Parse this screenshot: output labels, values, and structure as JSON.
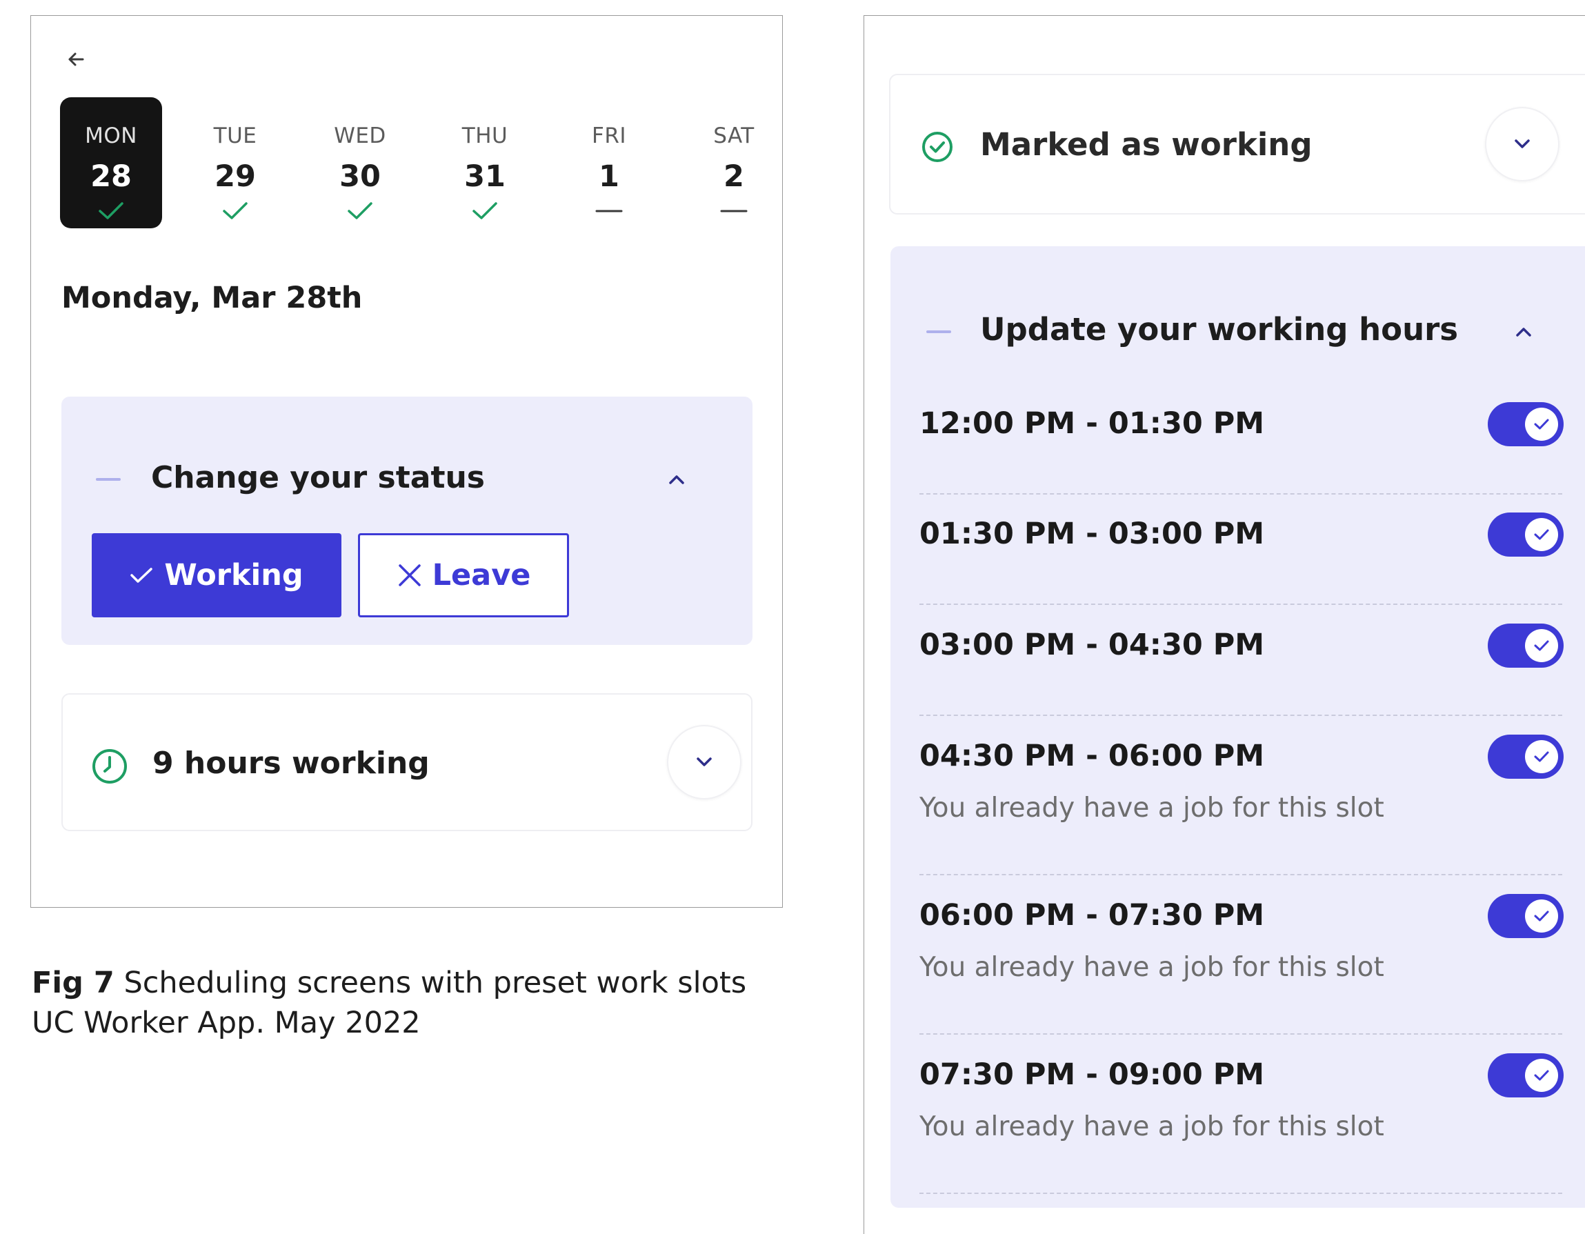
{
  "left_screen": {
    "back_icon": "arrow-left-icon",
    "days": [
      {
        "name": "MON",
        "num": "28",
        "mark": "check",
        "selected": true
      },
      {
        "name": "TUE",
        "num": "29",
        "mark": "check",
        "selected": false
      },
      {
        "name": "WED",
        "num": "30",
        "mark": "check",
        "selected": false
      },
      {
        "name": "THU",
        "num": "31",
        "mark": "check",
        "selected": false
      },
      {
        "name": "FRI",
        "num": "1",
        "mark": "dash",
        "selected": false
      },
      {
        "name": "SAT",
        "num": "2",
        "mark": "dash",
        "selected": false
      }
    ],
    "date_heading": "Monday, Mar 28th",
    "status_card": {
      "title": "Change your status",
      "working_label": "Working",
      "leave_label": "Leave",
      "active_option": "Working"
    },
    "hours_card": {
      "label": "9 hours working"
    }
  },
  "caption": {
    "fig": "Fig 7",
    "line1": "Scheduling screens with preset work slots",
    "line2": "UC Worker App. May 2022"
  },
  "right_screen": {
    "marked_card": {
      "label": "Marked as working"
    },
    "hours_panel": {
      "title": "Update your working hours",
      "slots": [
        {
          "time": "12:00 PM - 01:30 PM",
          "note": "",
          "enabled": true
        },
        {
          "time": "01:30 PM - 03:00 PM",
          "note": "",
          "enabled": true
        },
        {
          "time": "03:00 PM - 04:30 PM",
          "note": "",
          "enabled": true
        },
        {
          "time": "04:30 PM - 06:00 PM",
          "note": "You already have a job for this slot",
          "enabled": true
        },
        {
          "time": "06:00 PM - 07:30 PM",
          "note": "You already have a job for this slot",
          "enabled": true
        },
        {
          "time": "07:30 PM - 09:00 PM",
          "note": "You already have a job for this slot",
          "enabled": true
        }
      ]
    }
  },
  "colors": {
    "accent": "#3d3ad6",
    "card_tint": "#ededfb",
    "success": "#1e9e63",
    "selected_day_bg": "#141414"
  }
}
